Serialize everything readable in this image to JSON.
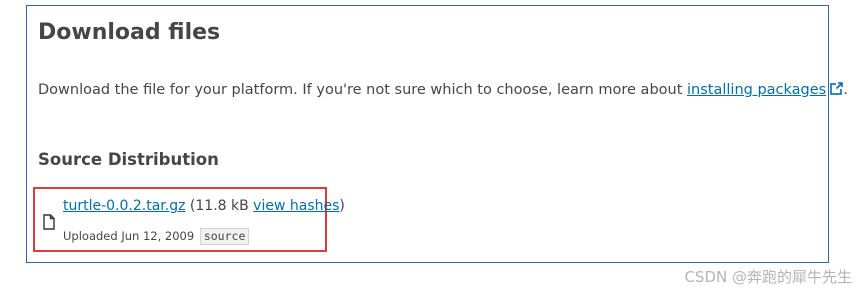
{
  "section": {
    "title": "Download files",
    "intro_prefix": "Download the file for your platform. If you're not sure which to choose, learn more about ",
    "intro_link": "installing packages",
    "intro_suffix": "."
  },
  "source_distribution": {
    "title": "Source Distribution",
    "file": {
      "name": "turtle-0.0.2.tar.gz",
      "size_open": " (11.8 kB ",
      "view_hashes": "view hashes",
      "size_close": ")",
      "uploaded": "Uploaded Jun 12, 2009",
      "badge": "source"
    }
  },
  "watermark": "CSDN @奔跑的犀牛先生",
  "icons": [
    "external-link-icon",
    "file-icon"
  ],
  "colors": {
    "border": "#336699",
    "link": "#006dad",
    "highlight": "#e03b3b"
  }
}
